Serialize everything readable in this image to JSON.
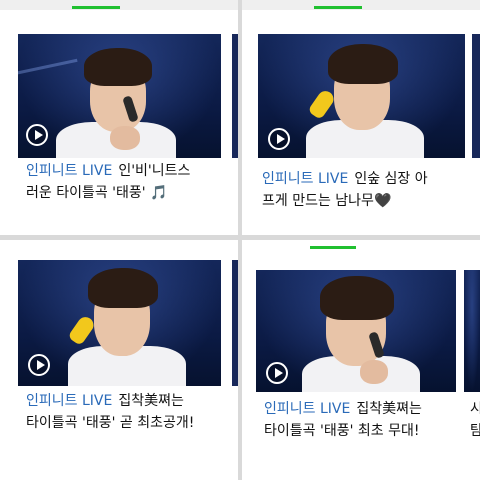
{
  "cards": [
    {
      "category": "인피니트 LIVE",
      "line1": "인'비'니트스",
      "line2": "러운 타이틀곡 '태풍'",
      "emoji": "🎵"
    },
    {
      "category": "인피니트 LIVE",
      "line1": "인숲 심장 아",
      "line2": "프게 만드는 남나무",
      "emoji": "🖤"
    },
    {
      "category": "인피니트 LIVE",
      "line1": "집착美쪄는",
      "line2": "타이틀곡 '태풍' 곧 최초공개!",
      "emoji": ""
    },
    {
      "category": "인피니트 LIVE",
      "line1": "집착美쪄는",
      "line2": "타이틀곡 '태풍' 최초 무대!",
      "emoji": ""
    }
  ],
  "partial_text": {
    "line1": "시",
    "line2": "탐"
  },
  "colors": {
    "accent_green": "#20c030",
    "category_blue": "#2a6ab8"
  },
  "icons": [
    "play-icon"
  ]
}
